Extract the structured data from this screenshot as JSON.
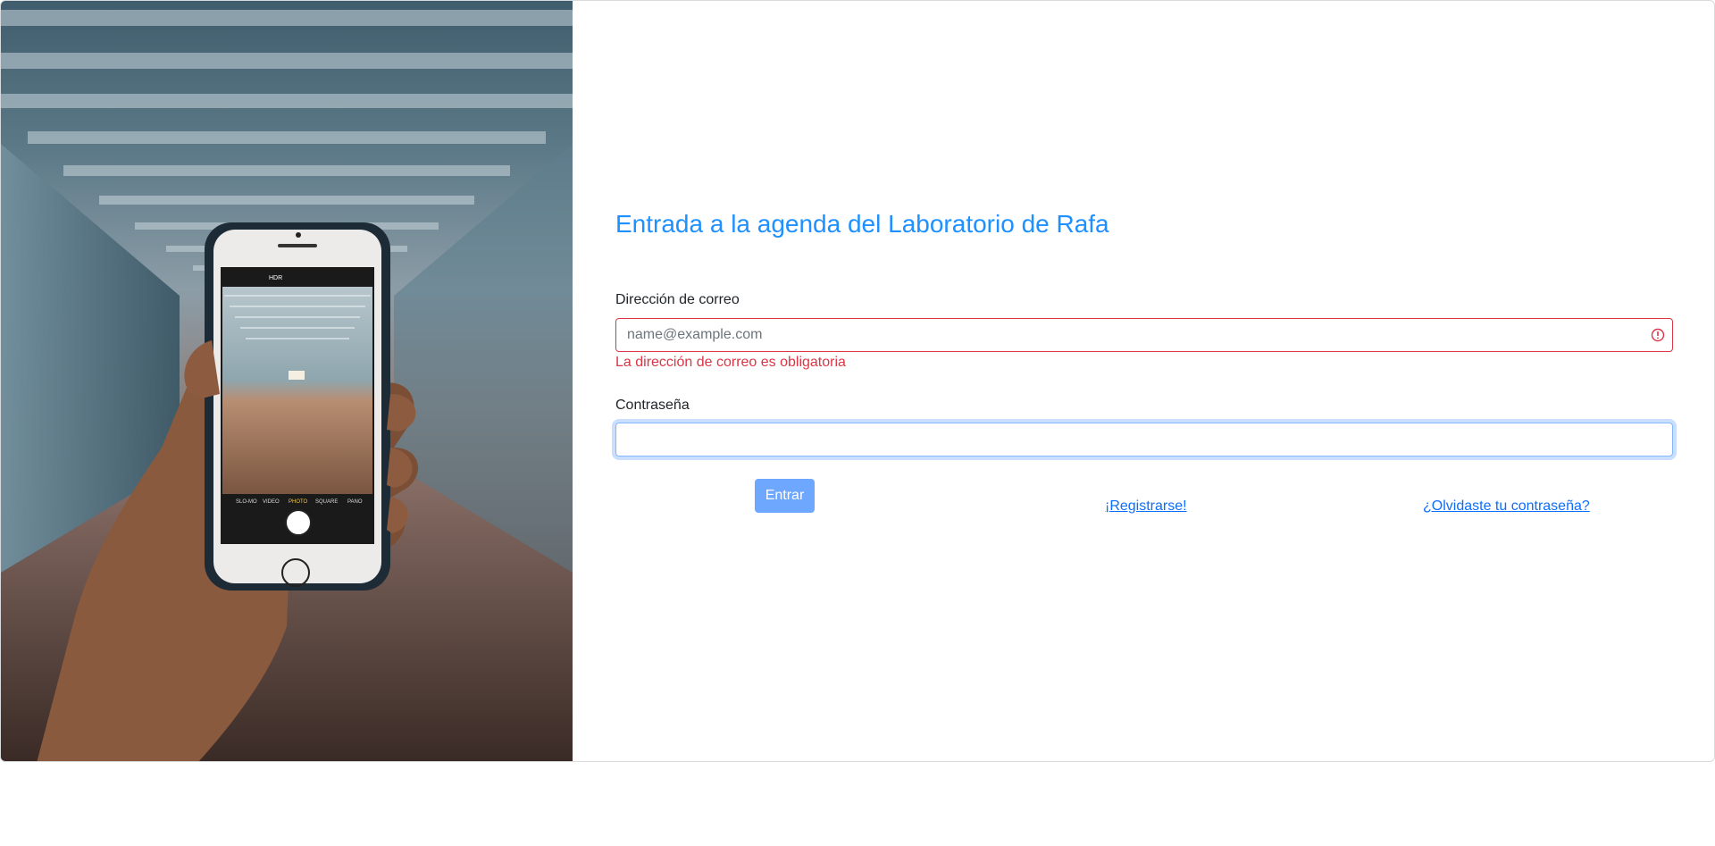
{
  "page": {
    "title": "Entrada a la agenda del Laboratorio de Rafa"
  },
  "photo": {
    "description_icon": "hand-holding-phone-image",
    "camera_modes": [
      "SLO-MO",
      "VIDEO",
      "PHOTO",
      "SQUARE",
      "PANO"
    ],
    "hdr_label": "HDR"
  },
  "form": {
    "email": {
      "label": "Dirección de correo",
      "value": "",
      "placeholder": "name@example.com",
      "error": "La dirección de correo es obligatoria"
    },
    "password": {
      "label": "Contraseña",
      "value": ""
    },
    "submit_label": "Entrar",
    "register_link": "¡Registrarse!",
    "forgot_link": "¿Olvidaste tu contraseña?"
  },
  "colors": {
    "title": "#1e90ff",
    "error": "#dc3545",
    "button": "#6ea8fe",
    "link": "#0d6efd"
  }
}
